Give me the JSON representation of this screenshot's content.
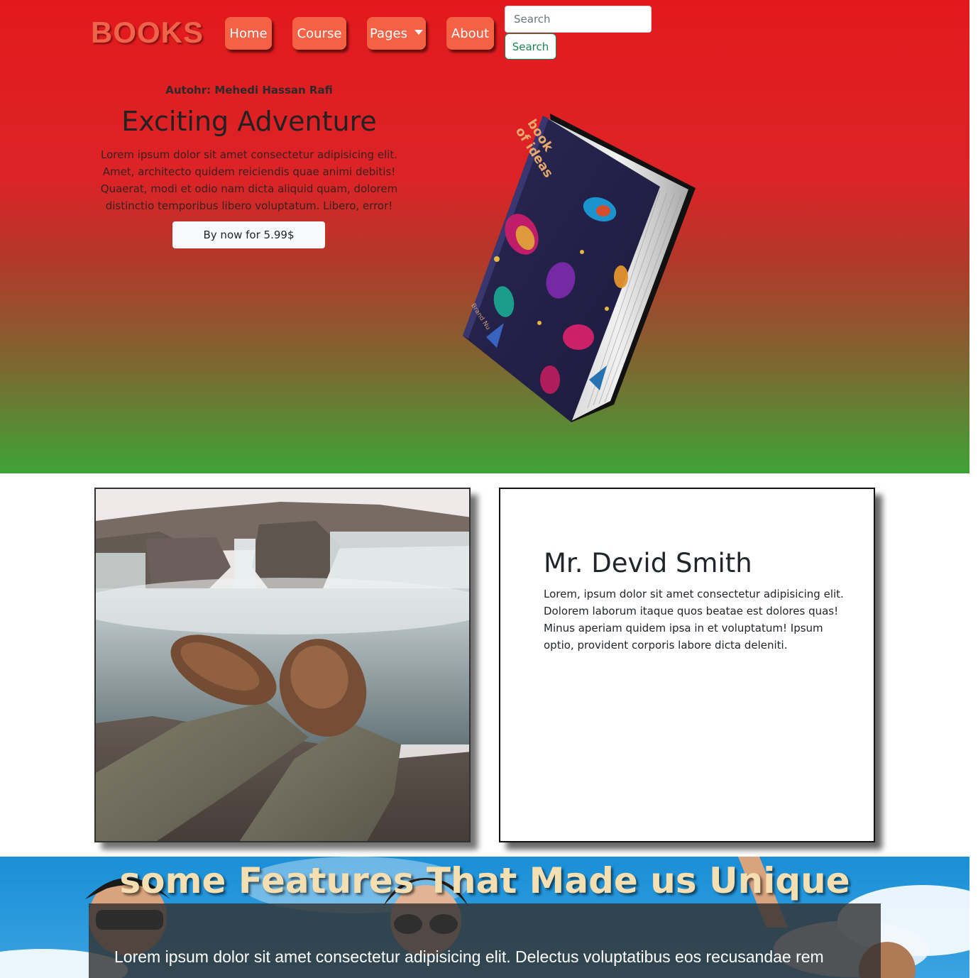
{
  "navbar": {
    "brand": "BOOKS",
    "items": [
      {
        "label": "Home"
      },
      {
        "label": "Course"
      },
      {
        "label": "Pages"
      },
      {
        "label": "About"
      }
    ],
    "search": {
      "placeholder": "Search",
      "button_label": "Search"
    }
  },
  "hero": {
    "author": "Autohr: Mehedi Hassan Rafi",
    "title": "Exciting Adventure",
    "description": "Lorem ipsum dolor sit amet consectetur adipisicing elit. Amet, architecto quidem reiciendis quae animi debitis! Quaerat, modi et odio nam dicta aliquid quam, dolorem distinctio temporibus libero voluptatum. Libero, error!",
    "buy_label": "By now for 5.99$",
    "book": {
      "title_line1": "book",
      "title_line2": "of ideas",
      "publisher": "Brand Nu"
    }
  },
  "profile": {
    "name": "Mr. Devid Smith",
    "bio": "Lorem, ipsum dolor sit amet consectetur adipisicing elit. Dolorem laborum itaque quos beatae est dolores quas! Minus aperiam quidem ipsa in et voluptatum! Ipsum optio, provident corporis labore dicta deleniti."
  },
  "features": {
    "title": "some Features That Made us Unique",
    "text": "Lorem ipsum dolor sit amet consectetur adipisicing elit. Delectus voluptatibus eos recusandae rem"
  },
  "colors": {
    "brand": "#f0634b",
    "nav_button": "#f46145",
    "hero_top": "#e2191c",
    "hero_bottom": "#3ea337",
    "search_button": "#198754",
    "features_title": "#f3dfb1"
  }
}
